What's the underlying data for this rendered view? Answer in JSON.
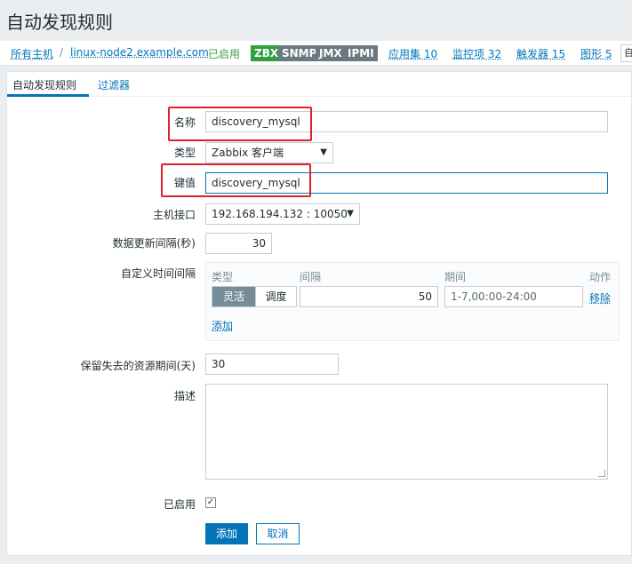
{
  "page": {
    "title": "自动发现规则"
  },
  "breadcrumb": {
    "all_hosts": "所有主机",
    "sep": "/",
    "host": "linux-node2.example.com",
    "status": "已启用",
    "badges": [
      "ZBX",
      "SNMP",
      "JMX",
      "IPMI"
    ],
    "apps": "应用集 10",
    "items": "监控项 32",
    "triggers": "触发器 15",
    "graphs": "图形 5",
    "cut_tab": "自"
  },
  "tabs": {
    "rule": "自动发现规则",
    "filters": "过滤器"
  },
  "form": {
    "name_label": "名称",
    "name_value": "discovery_mysql",
    "type_label": "类型",
    "type_value": "Zabbix 客户端",
    "key_label": "键值",
    "key_value": "discovery_mysql",
    "interface_label": "主机接口",
    "interface_value": "192.168.194.132 : 10050",
    "delay_label": "数据更新间隔(秒)",
    "delay_value": "30",
    "custom_label": "自定义时间间隔",
    "custom": {
      "col_type": "类型",
      "col_interval": "间隔",
      "col_period": "期间",
      "col_action": "动作",
      "flex": "灵活",
      "schedule": "调度",
      "interval_value": "50",
      "period_value": "1-7,00:00-24:00",
      "remove": "移除",
      "add": "添加"
    },
    "lifetime_label": "保留失去的资源期间(天)",
    "lifetime_value": "30",
    "desc_label": "描述",
    "desc_value": "",
    "enabled_label": "已启用",
    "enabled_mark": "✓",
    "add_button": "添加",
    "cancel_button": "取消"
  },
  "colors": {
    "accent": "#0275b8",
    "highlight": "#e0202a",
    "enabled": "#429e47"
  }
}
